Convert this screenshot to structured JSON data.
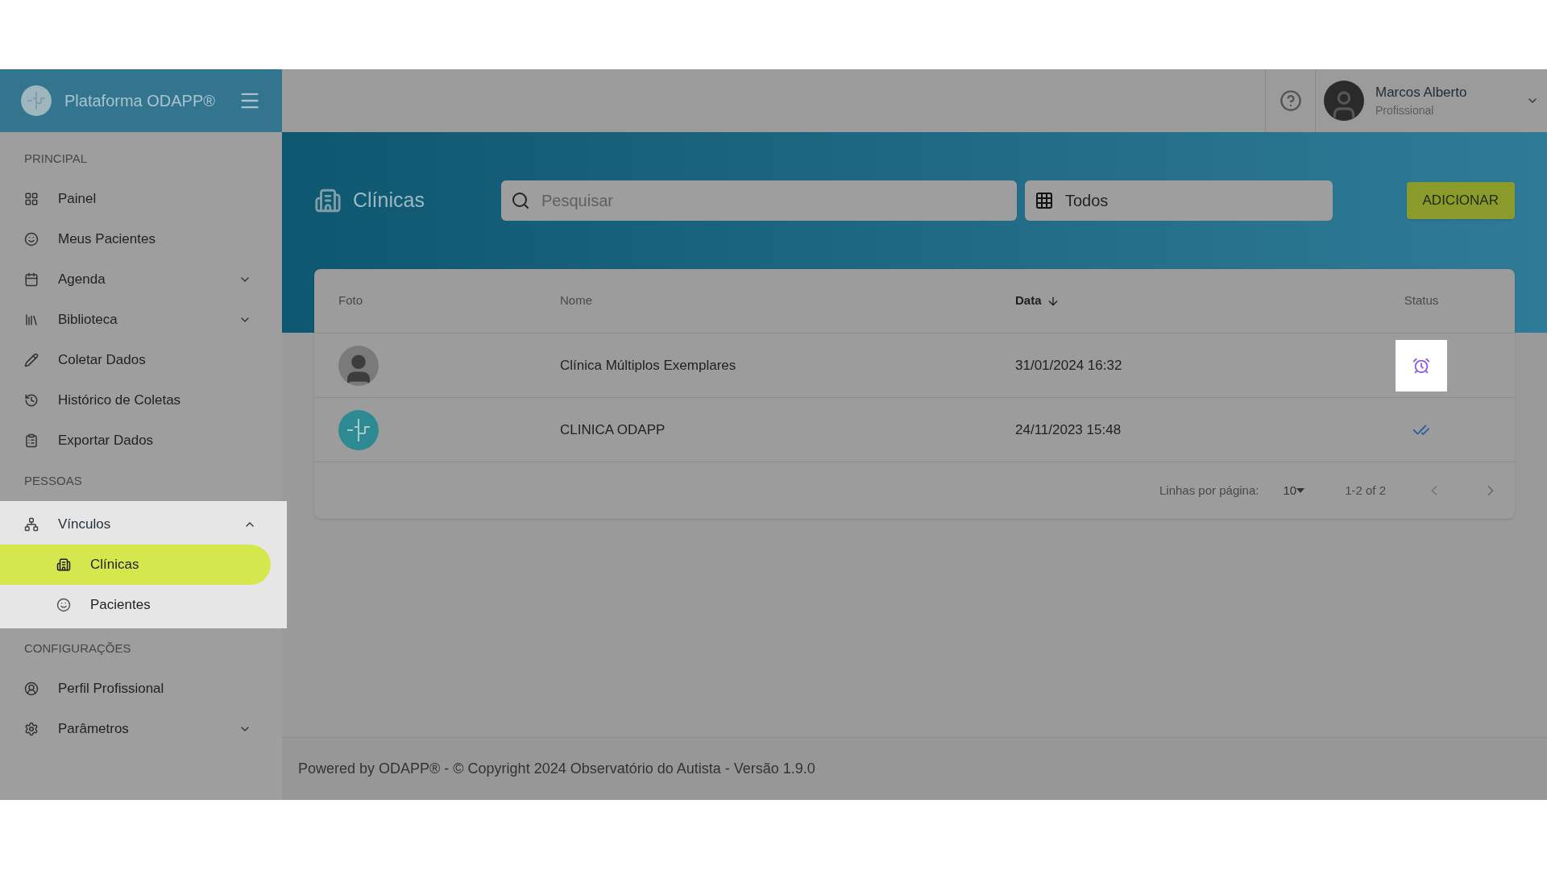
{
  "brand": {
    "title": "Plataforma ODAPP®"
  },
  "user": {
    "name": "Marcos Alberto",
    "role": "Profissional"
  },
  "sidebar": {
    "sections": [
      {
        "title": "PRINCIPAL",
        "items": [
          {
            "label": "Painel"
          },
          {
            "label": "Meus Pacientes"
          },
          {
            "label": "Agenda",
            "expanded": false
          },
          {
            "label": "Biblioteca",
            "expanded": false
          },
          {
            "label": "Coletar Dados"
          },
          {
            "label": "Histórico de Coletas"
          },
          {
            "label": "Exportar Dados"
          }
        ]
      },
      {
        "title": "PESSOAS",
        "items": [
          {
            "label": "Vínculos",
            "expanded": true,
            "highlighted": true,
            "children": [
              {
                "label": "Clínicas",
                "selected": true
              },
              {
                "label": "Pacientes",
                "selected": false
              }
            ]
          }
        ]
      },
      {
        "title": "CONFIGURAÇÕES",
        "items": [
          {
            "label": "Perfil Profissional"
          },
          {
            "label": "Parâmetros",
            "expanded": false
          }
        ]
      }
    ]
  },
  "page": {
    "title": "Clínicas",
    "search": {
      "placeholder": "Pesquisar"
    },
    "filter": {
      "value": "Todos"
    },
    "add_button": "ADICIONAR"
  },
  "table": {
    "columns": [
      {
        "label": "Foto",
        "sorted": false
      },
      {
        "label": "Nome",
        "sorted": false
      },
      {
        "label": "Data",
        "sorted": true
      },
      {
        "label": "Status",
        "sorted": false
      }
    ],
    "rows": [
      {
        "photo": {
          "kind": "silhouette"
        },
        "name": "Clínica Múltiplos Exemplares",
        "date": "31/01/2024 16:32",
        "status": {
          "kind": "pending"
        },
        "highlighted": true
      },
      {
        "photo": {
          "kind": "logo"
        },
        "name": "CLINICA ODAPP",
        "date": "24/11/2023 15:48",
        "status": {
          "kind": "done"
        },
        "highlighted": false
      }
    ],
    "pagination": {
      "rows_label": "Linhas por página:",
      "per_page": "10",
      "range": "1-2 of 2"
    }
  },
  "footer": "Powered by ODAPP® - © Copyright 2024 Observatório do Autista - Versão 1.9.0"
}
